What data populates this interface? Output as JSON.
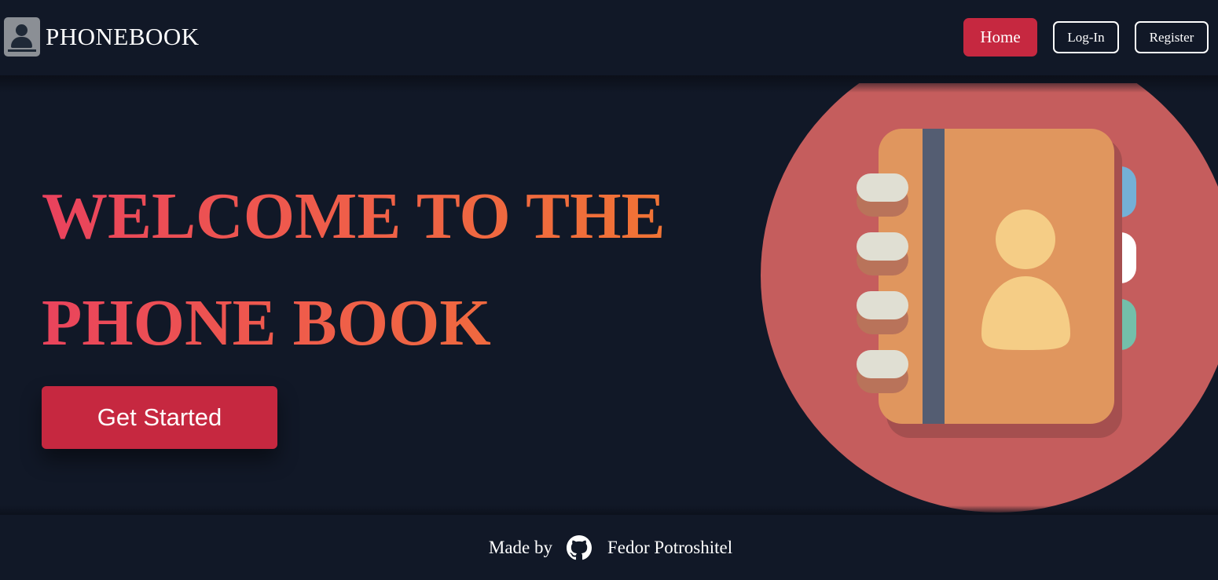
{
  "header": {
    "brand": "PHONEBOOK",
    "nav": {
      "home": "Home",
      "login": "Log-In",
      "register": "Register"
    }
  },
  "hero": {
    "title_line1": "WELCOME TO THE",
    "title_line2": "PHONE BOOK",
    "cta": "Get Started"
  },
  "footer": {
    "made_by": "Made by",
    "author": "Fedor Potroshitel",
    "icon": "github-icon"
  },
  "colors": {
    "background": "#111827",
    "accent": "#c62840",
    "circle": "#c55d5d",
    "book": "#e0965e"
  }
}
